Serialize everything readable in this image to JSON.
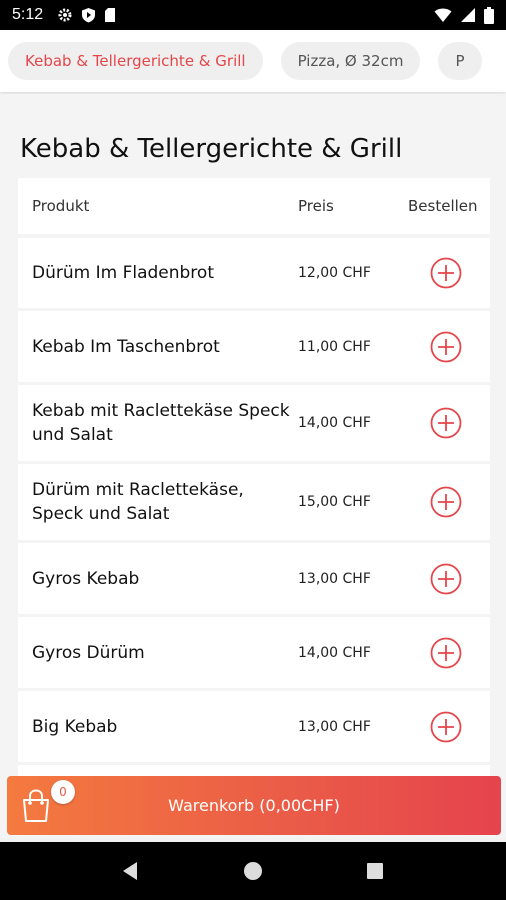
{
  "statusbar": {
    "time": "5:12"
  },
  "categories": [
    {
      "label": "Kebab & Tellergerichte & Grill",
      "active": true
    },
    {
      "label": "Pizza, Ø 32cm",
      "active": false
    },
    {
      "label": "P",
      "active": false
    }
  ],
  "section": {
    "title": "Kebab & Tellergerichte & Grill"
  },
  "table": {
    "headers": {
      "product": "Produkt",
      "price": "Preis",
      "order": "Bestellen"
    },
    "rows": [
      {
        "name": "Dürüm Im Fladenbrot",
        "price": "12,00 CHF"
      },
      {
        "name": "Kebab Im Taschenbrot",
        "price": "11,00 CHF"
      },
      {
        "name": "Kebab mit Raclettekäse Speck und Salat",
        "price": "14,00 CHF"
      },
      {
        "name": "Dürüm mit Raclettekäse, Speck und Salat",
        "price": "15,00 CHF"
      },
      {
        "name": "Gyros Kebab",
        "price": "13,00 CHF"
      },
      {
        "name": "Gyros Dürüm",
        "price": "14,00 CHF"
      },
      {
        "name": "Big Kebab",
        "price": "13,00 CHF"
      },
      {
        "name": "",
        "price": ""
      }
    ]
  },
  "cart": {
    "label": "Warenkorb (0,00CHF)",
    "count": "0"
  },
  "colors": {
    "accent": "#e4464a",
    "cart_start": "#f47a3f",
    "cart_end": "#e5434d"
  },
  "icons": {
    "add": "plus-circle-icon",
    "cart": "shopping-bag-icon"
  }
}
